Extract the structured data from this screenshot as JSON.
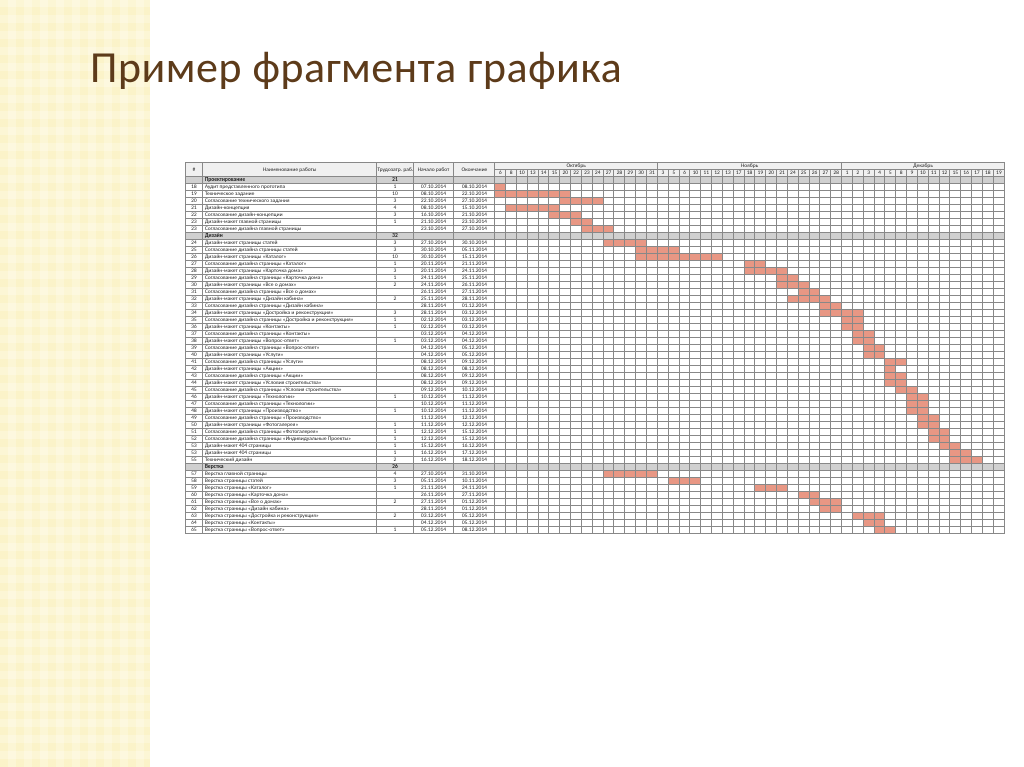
{
  "slide_title": "Пример фрагмента графика",
  "chart_data": {
    "type": "table",
    "title": "Пример фрагмента графика",
    "columns": [
      "#",
      "Наименование работы",
      "Трудозатр. раб.дн.",
      "Начало работ",
      "Окончание"
    ],
    "months": [
      {
        "name": "Октябрь",
        "days": [
          6,
          8,
          10,
          13,
          14,
          15,
          20,
          22,
          23,
          24,
          27,
          28,
          29,
          30,
          31
        ]
      },
      {
        "name": "Ноябрь",
        "days": [
          3,
          5,
          6,
          10,
          11,
          12,
          13,
          17,
          18,
          19,
          20,
          21,
          24,
          25,
          26,
          27,
          28
        ]
      },
      {
        "name": "Декабрь",
        "days": [
          1,
          2,
          3,
          4,
          5,
          8,
          9,
          10,
          11,
          12,
          15,
          16,
          17,
          18,
          19
        ]
      }
    ],
    "rows": [
      {
        "num": "",
        "name": "Проектирование",
        "dur": "21",
        "start": "",
        "end": "",
        "section": true
      },
      {
        "num": "18",
        "name": "Аудит представленного прототипа",
        "dur": "1",
        "start": "07.10.2014",
        "end": "08.10.2014",
        "bar": [
          0,
          0
        ]
      },
      {
        "num": "19",
        "name": "Техническое задание",
        "dur": "10",
        "start": "08.10.2014",
        "end": "22.10.2014",
        "bar": [
          0,
          6
        ]
      },
      {
        "num": "20",
        "name": "Согласование технического задания",
        "dur": "3",
        "start": "22.10.2014",
        "end": "27.10.2014",
        "bar": [
          6,
          9
        ]
      },
      {
        "num": "21",
        "name": "Дизайн-концепция",
        "dur": "4",
        "start": "08.10.2014",
        "end": "15.10.2014",
        "bar": [
          1,
          5
        ]
      },
      {
        "num": "22",
        "name": "Согласование дизайн-концепции",
        "dur": "3",
        "start": "16.10.2014",
        "end": "21.10.2014",
        "bar": [
          5,
          7
        ]
      },
      {
        "num": "23",
        "name": "Дизайн-макет главной страницы",
        "dur": "1",
        "start": "21.10.2014",
        "end": "23.10.2014",
        "bar": [
          7,
          8
        ]
      },
      {
        "num": "23",
        "name": "Согласование дизайна главной страницы",
        "dur": "",
        "start": "23.10.2014",
        "end": "27.10.2014",
        "bar": [
          8,
          10
        ]
      },
      {
        "num": "",
        "name": "Дизайн",
        "dur": "32",
        "start": "",
        "end": "",
        "section": true
      },
      {
        "num": "24",
        "name": "Дизайн-макет страницы статей",
        "dur": "3",
        "start": "27.10.2014",
        "end": "30.10.2014",
        "bar": [
          10,
          13
        ]
      },
      {
        "num": "25",
        "name": "Согласование дизайна страницы статей",
        "dur": "3",
        "start": "30.10.2014",
        "end": "05.11.2014",
        "bar": [
          13,
          16
        ]
      },
      {
        "num": "26",
        "name": "Дизайн-макет страницы «Каталог»",
        "dur": "10",
        "start": "30.10.2014",
        "end": "15.11.2014",
        "bar": [
          13,
          20
        ]
      },
      {
        "num": "27",
        "name": "Согласование дизайна страницы «Каталог»",
        "dur": "1",
        "start": "20.11.2014",
        "end": "21.11.2014",
        "bar": [
          23,
          24
        ]
      },
      {
        "num": "28",
        "name": "Дизайн-макет страницы «Карточка дома»",
        "dur": "3",
        "start": "20.11.2014",
        "end": "24.11.2014",
        "bar": [
          23,
          26
        ]
      },
      {
        "num": "29",
        "name": "Согласование дизайна страницы «Карточка дома»",
        "dur": "1",
        "start": "24.11.2014",
        "end": "25.11.2014",
        "bar": [
          26,
          27
        ]
      },
      {
        "num": "30",
        "name": "Дизайн-макет страницы «Все о домах»",
        "dur": "2",
        "start": "24.11.2014",
        "end": "26.11.2014",
        "bar": [
          26,
          28
        ]
      },
      {
        "num": "31",
        "name": "Согласование дизайна страницы «Все о домах»",
        "dur": "",
        "start": "26.11.2014",
        "end": "27.11.2014",
        "bar": [
          28,
          29
        ]
      },
      {
        "num": "32",
        "name": "Дизайн-макет страницы «Дизайн кабина»",
        "dur": "2",
        "start": "25.11.2014",
        "end": "28.11.2014",
        "bar": [
          27,
          30
        ]
      },
      {
        "num": "33",
        "name": "Согласование дизайна страницы «Дизайн кабина»",
        "dur": "",
        "start": "28.11.2014",
        "end": "01.12.2014",
        "bar": [
          30,
          31
        ]
      },
      {
        "num": "34",
        "name": "Дизайн-макет страницы «Достройка и реконструкция»",
        "dur": "3",
        "start": "28.11.2014",
        "end": "03.12.2014",
        "bar": [
          30,
          33
        ]
      },
      {
        "num": "35",
        "name": "Согласование дизайна страницы «Достройка и реконструкция»",
        "dur": "1",
        "start": "02.12.2014",
        "end": "03.12.2014",
        "bar": [
          32,
          33
        ]
      },
      {
        "num": "36",
        "name": "Дизайн-макет страницы «Контакты»",
        "dur": "1",
        "start": "02.12.2014",
        "end": "03.12.2014",
        "bar": [
          32,
          33
        ]
      },
      {
        "num": "37",
        "name": "Согласование дизайна страницы «Контакты»",
        "dur": "",
        "start": "03.12.2014",
        "end": "04.12.2014",
        "bar": [
          33,
          34
        ]
      },
      {
        "num": "38",
        "name": "Дизайн-макет страницы «Вопрос-ответ»",
        "dur": "1",
        "start": "03.12.2014",
        "end": "04.12.2014",
        "bar": [
          33,
          34
        ]
      },
      {
        "num": "39",
        "name": "Согласование дизайна страницы «Вопрос-ответ»",
        "dur": "",
        "start": "04.12.2014",
        "end": "05.12.2014",
        "bar": [
          34,
          35
        ]
      },
      {
        "num": "40",
        "name": "Дизайн-макет страницы «Услуги»",
        "dur": "",
        "start": "04.12.2014",
        "end": "05.12.2014",
        "bar": [
          34,
          35
        ]
      },
      {
        "num": "41",
        "name": "Согласование дизайна страницы «Услуги»",
        "dur": "",
        "start": "08.12.2014",
        "end": "09.12.2014",
        "bar": [
          36,
          37
        ]
      },
      {
        "num": "42",
        "name": "Дизайн-макет страницы «Акции»",
        "dur": "",
        "start": "08.12.2014",
        "end": "08.12.2014",
        "bar": [
          36,
          36
        ]
      },
      {
        "num": "43",
        "name": "Согласование дизайна страницы «Акции»",
        "dur": "",
        "start": "08.12.2014",
        "end": "09.12.2014",
        "bar": [
          36,
          37
        ]
      },
      {
        "num": "44",
        "name": "Дизайн-макет страницы «Условия строительства»",
        "dur": "",
        "start": "08.12.2014",
        "end": "09.12.2014",
        "bar": [
          36,
          37
        ]
      },
      {
        "num": "45",
        "name": "Согласование дизайна страницы «Условия строительства»",
        "dur": "",
        "start": "09.12.2014",
        "end": "10.12.2014",
        "bar": [
          37,
          38
        ]
      },
      {
        "num": "46",
        "name": "Дизайн-макет страницы «Технологии»",
        "dur": "1",
        "start": "10.12.2014",
        "end": "11.12.2014",
        "bar": [
          38,
          39
        ]
      },
      {
        "num": "47",
        "name": "Согласование дизайна страницы «Технологии»",
        "dur": "",
        "start": "10.12.2014",
        "end": "11.12.2014",
        "bar": [
          38,
          39
        ]
      },
      {
        "num": "48",
        "name": "Дизайн-макет страницы «Производство»",
        "dur": "1",
        "start": "10.12.2014",
        "end": "11.12.2014",
        "bar": [
          38,
          39
        ]
      },
      {
        "num": "49",
        "name": "Согласование дизайна страницы «Производство»",
        "dur": "",
        "start": "11.12.2014",
        "end": "12.12.2014",
        "bar": [
          39,
          40
        ]
      },
      {
        "num": "50",
        "name": "Дизайн-макет страницы «Фотогалерея»",
        "dur": "1",
        "start": "11.12.2014",
        "end": "12.12.2014",
        "bar": [
          39,
          40
        ]
      },
      {
        "num": "51",
        "name": "Согласование дизайна страницы «Фотогалерея»",
        "dur": "1",
        "start": "12.12.2014",
        "end": "15.12.2014",
        "bar": [
          40,
          41
        ]
      },
      {
        "num": "52",
        "name": "Согласование дизайна страницы «Индивидуальные Проекты»",
        "dur": "1",
        "start": "12.12.2014",
        "end": "15.12.2014",
        "bar": [
          40,
          41
        ]
      },
      {
        "num": "53",
        "name": "Дизайн-макет 404 страницы",
        "dur": "1",
        "start": "15.12.2014",
        "end": "16.12.2014",
        "bar": [
          41,
          42
        ]
      },
      {
        "num": "53",
        "name": "Дизайн-макет 404 страницы",
        "dur": "1",
        "start": "16.12.2014",
        "end": "17.12.2014",
        "bar": [
          42,
          43
        ]
      },
      {
        "num": "55",
        "name": "Технический дизайн",
        "dur": "2",
        "start": "16.12.2014",
        "end": "18.12.2014",
        "bar": [
          42,
          44
        ]
      },
      {
        "num": "",
        "name": "Верстка",
        "dur": "26",
        "start": "",
        "end": "",
        "section": true
      },
      {
        "num": "57",
        "name": "Верстка главной страницы",
        "dur": "4",
        "start": "27.10.2014",
        "end": "31.10.2014",
        "bar": [
          10,
          14
        ]
      },
      {
        "num": "58",
        "name": "Верстка страницы статей",
        "dur": "3",
        "start": "05.11.2014",
        "end": "10.11.2014",
        "bar": [
          16,
          18
        ]
      },
      {
        "num": "59",
        "name": "Верстка страницы «Каталог»",
        "dur": "1",
        "start": "21.11.2014",
        "end": "24.11.2014",
        "bar": [
          24,
          26
        ]
      },
      {
        "num": "60",
        "name": "Верстка страницы «Карточка дома»",
        "dur": "",
        "start": "26.11.2014",
        "end": "27.11.2014",
        "bar": [
          28,
          29
        ]
      },
      {
        "num": "61",
        "name": "Верстка страницы «Все о домах»",
        "dur": "2",
        "start": "27.11.2014",
        "end": "01.12.2014",
        "bar": [
          29,
          31
        ]
      },
      {
        "num": "62",
        "name": "Верстка страницы «Дизайн кабина»",
        "dur": "",
        "start": "28.11.2014",
        "end": "01.12.2014",
        "bar": [
          30,
          31
        ]
      },
      {
        "num": "63",
        "name": "Верстка страницы «Достройка и реконструкция»",
        "dur": "2",
        "start": "03.12.2014",
        "end": "05.12.2014",
        "bar": [
          33,
          35
        ]
      },
      {
        "num": "64",
        "name": "Верстка страницы «Контакты»",
        "dur": "",
        "start": "04.12.2014",
        "end": "05.12.2014",
        "bar": [
          34,
          35
        ]
      },
      {
        "num": "65",
        "name": "Верстка страницы «Вопрос-ответ»",
        "dur": "1",
        "start": "05.12.2014",
        "end": "08.12.2014",
        "bar": [
          35,
          36
        ]
      }
    ]
  }
}
